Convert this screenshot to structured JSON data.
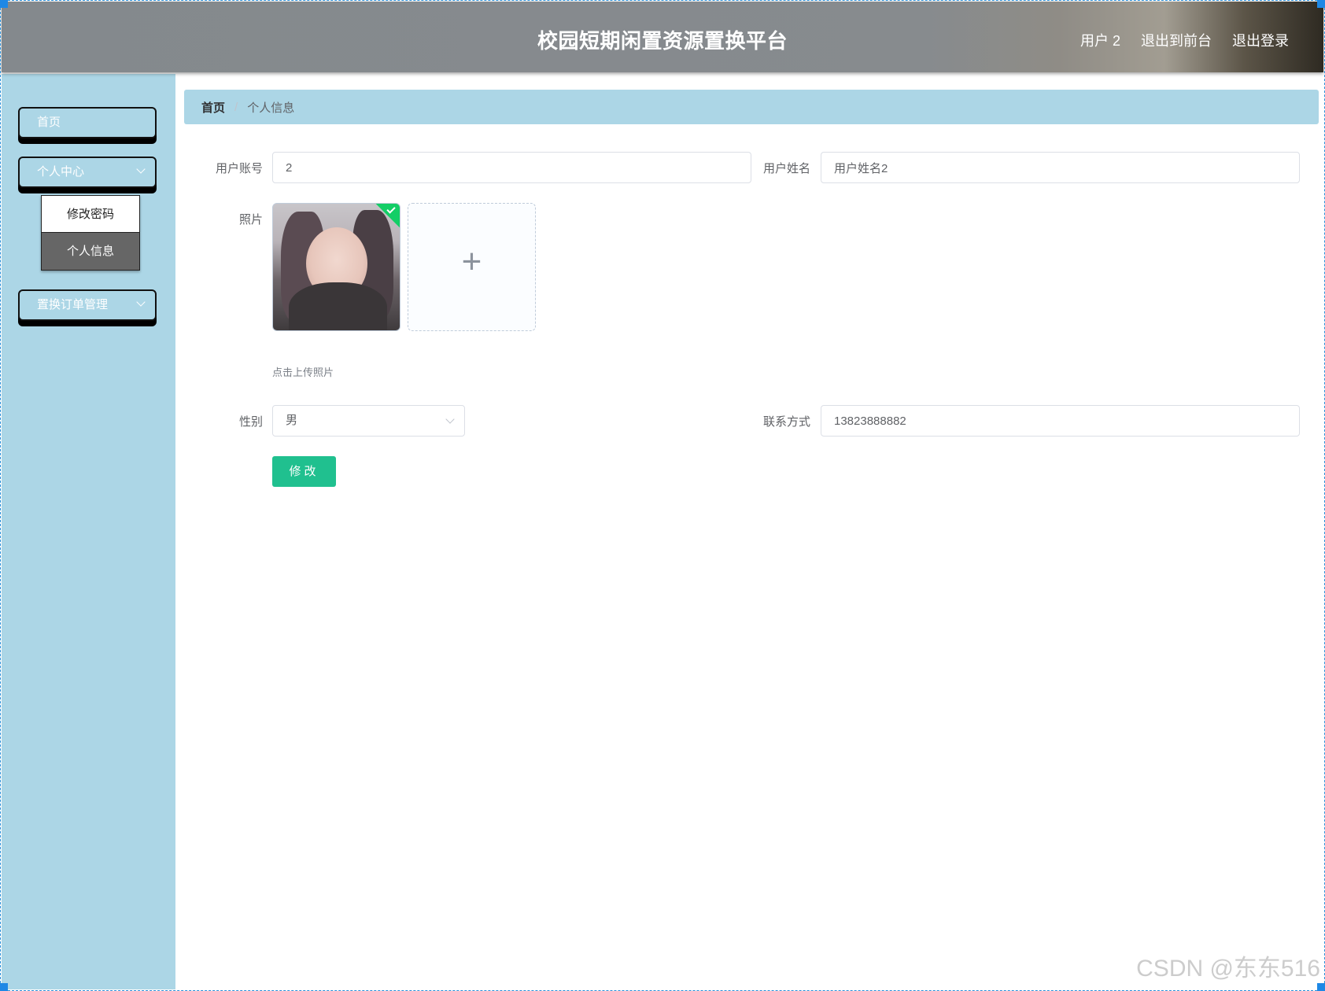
{
  "header": {
    "title": "校园短期闲置资源置换平台",
    "user_label": "用户 2",
    "back_label": "退出到前台",
    "logout_label": "退出登录"
  },
  "sidebar": {
    "items": [
      {
        "label": "首页"
      },
      {
        "label": "个人中心",
        "icon": "chevron-down-icon"
      },
      {
        "label": "置换订单管理",
        "icon": "chevron-down-icon"
      }
    ],
    "submenu": [
      {
        "label": "修改密码"
      },
      {
        "label": "个人信息"
      }
    ]
  },
  "breadcrumb": {
    "home": "首页",
    "separator": "/",
    "current": "个人信息"
  },
  "form": {
    "account_label": "用户账号",
    "account_value": "2",
    "name_label": "用户姓名",
    "name_value": "用户姓名2",
    "photo_label": "照片",
    "upload_icon": "plus-icon",
    "upload_tip": "点击上传照片",
    "gender_label": "性别",
    "gender_value": "男",
    "contact_label": "联系方式",
    "contact_value": "13823888882",
    "submit_label": "修改"
  },
  "watermark": "CSDN @东东516",
  "colors": {
    "sidebar_bg": "#acd6e6",
    "accent_green": "#20c08f",
    "submenu_active": "#666666"
  }
}
